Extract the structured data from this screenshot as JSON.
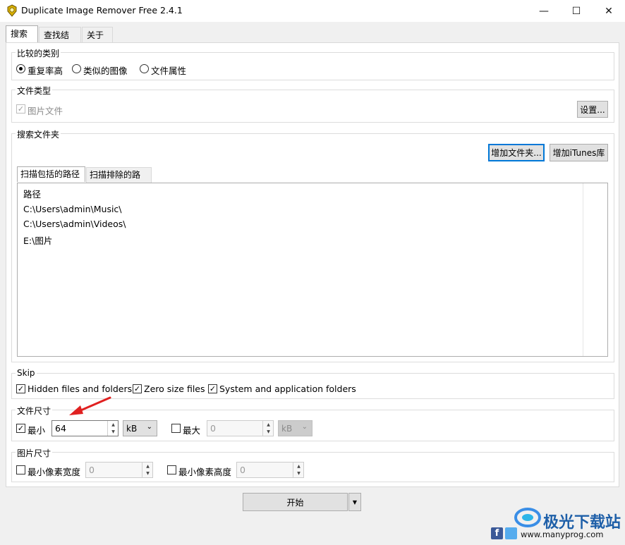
{
  "window": {
    "title": "Duplicate Image Remover Free 2.4.1",
    "minimize_glyph": "—",
    "maximize_glyph": "☐",
    "close_glyph": "✕"
  },
  "tabs": [
    "搜索",
    "查找结果",
    "关于"
  ],
  "compare_type": {
    "label": "比较的类别",
    "options": [
      {
        "label": "重复率高",
        "selected": true
      },
      {
        "label": "类似的图像",
        "selected": false
      },
      {
        "label": "文件属性",
        "selected": false
      }
    ]
  },
  "file_type": {
    "label": "文件类型",
    "image_files_label": "图片文件",
    "image_files_checked": true,
    "settings_button": "设置..."
  },
  "search_folders": {
    "label": "搜索文件夹",
    "add_folder_button": "增加文件夹...",
    "add_itunes_button": "增加iTunes库",
    "tabs": [
      "扫描包括的路径",
      "扫描排除的路径"
    ],
    "column_header": "路径",
    "paths": [
      "C:\\Users\\admin\\Music\\",
      "C:\\Users\\admin\\Videos\\",
      "E:\\图片"
    ]
  },
  "skip": {
    "label": "Skip",
    "hidden": "Hidden files and folders",
    "zero": "Zero size files",
    "system": "System and application folders"
  },
  "file_size": {
    "label": "文件尺寸",
    "min_label": "最小",
    "min_checked": true,
    "min_value": "64",
    "min_unit": "kB",
    "max_label": "最大",
    "max_checked": false,
    "max_value": "0",
    "max_unit": "kB"
  },
  "image_size": {
    "label": "图片尺寸",
    "min_width_label": "最小像素宽度",
    "min_width_value": "0",
    "min_height_label": "最小像素高度",
    "min_height_value": "0"
  },
  "start_button": "开始",
  "watermark": {
    "text": "极光下载站",
    "url": "www.manyprog.com"
  },
  "colors": {
    "accent": "#0078d7",
    "annotation_arrow": "#e02020",
    "facebook": "#3b5998",
    "twitter": "#55acee"
  }
}
